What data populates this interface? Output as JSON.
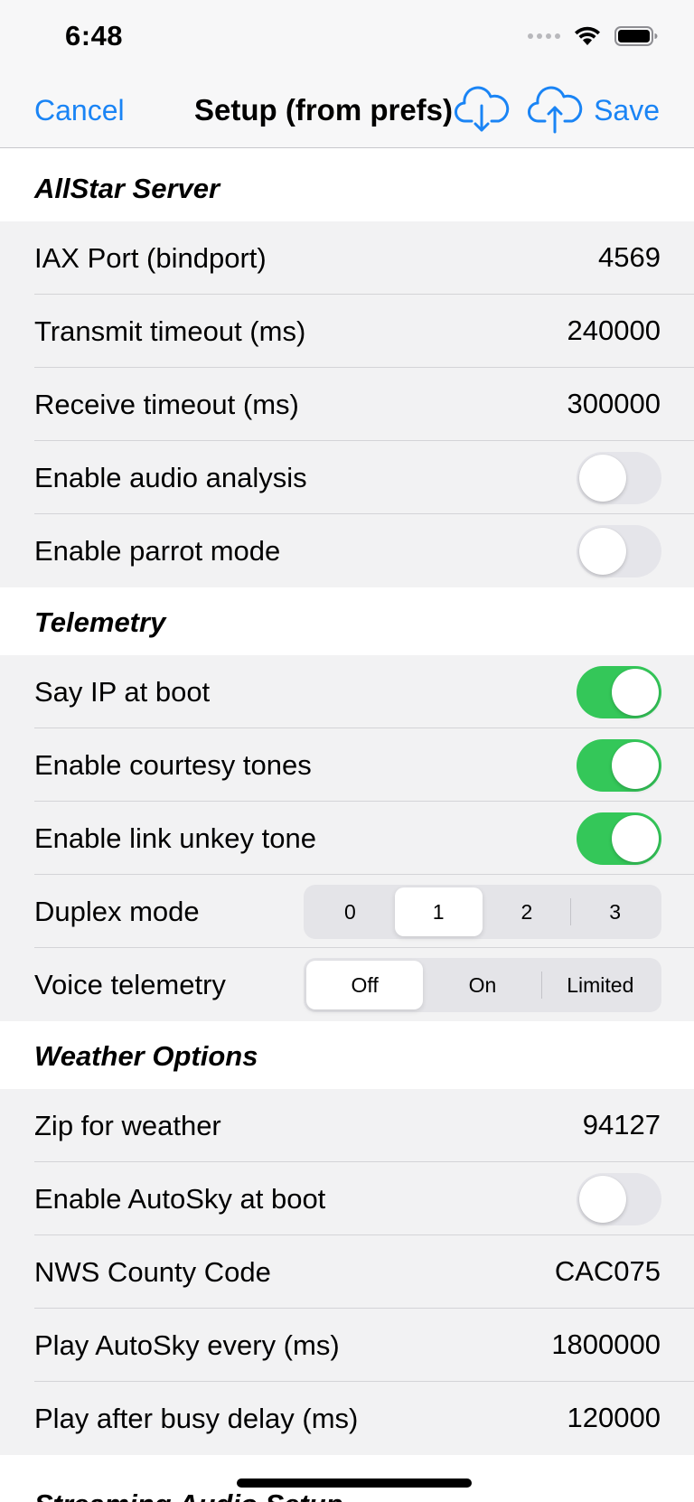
{
  "status_bar": {
    "time": "6:48"
  },
  "nav": {
    "cancel_label": "Cancel",
    "title": "Setup (from prefs)",
    "download_icon": "cloud-download-icon",
    "upload_icon": "cloud-upload-icon",
    "save_label": "Save",
    "accent_color": "#1a84f5"
  },
  "sections": {
    "allstar": {
      "header": "AllStar Server",
      "iax_port_label": "IAX Port (bindport)",
      "iax_port_value": "4569",
      "transmit_timeout_label": "Transmit timeout (ms)",
      "transmit_timeout_value": "240000",
      "receive_timeout_label": "Receive timeout (ms)",
      "receive_timeout_value": "300000",
      "audio_analysis_label": "Enable audio analysis",
      "audio_analysis_on": false,
      "parrot_mode_label": "Enable parrot mode",
      "parrot_mode_on": false
    },
    "telemetry": {
      "header": "Telemetry",
      "say_ip_label": "Say IP at boot",
      "say_ip_on": true,
      "courtesy_tones_label": "Enable courtesy tones",
      "courtesy_tones_on": true,
      "link_unkey_label": "Enable link unkey tone",
      "link_unkey_on": true,
      "duplex_label": "Duplex mode",
      "duplex_options": [
        "0",
        "1",
        "2",
        "3"
      ],
      "duplex_selected": "1",
      "voice_label": "Voice telemetry",
      "voice_options": [
        "Off",
        "On",
        "Limited"
      ],
      "voice_selected": "Off"
    },
    "weather": {
      "header": "Weather Options",
      "zip_label": "Zip for weather",
      "zip_value": "94127",
      "autosky_label": "Enable AutoSky at boot",
      "autosky_on": false,
      "nws_label": "NWS County Code",
      "nws_value": "CAC075",
      "play_every_label": "Play AutoSky every (ms)",
      "play_every_value": "1800000",
      "busy_delay_label": "Play after busy delay (ms)",
      "busy_delay_value": "120000"
    },
    "streaming": {
      "header": "Streaming Audio Setup"
    }
  },
  "colors": {
    "toggle_on": "#34c759",
    "toggle_off": "#e5e5ea",
    "group_background": "#f2f2f3"
  }
}
